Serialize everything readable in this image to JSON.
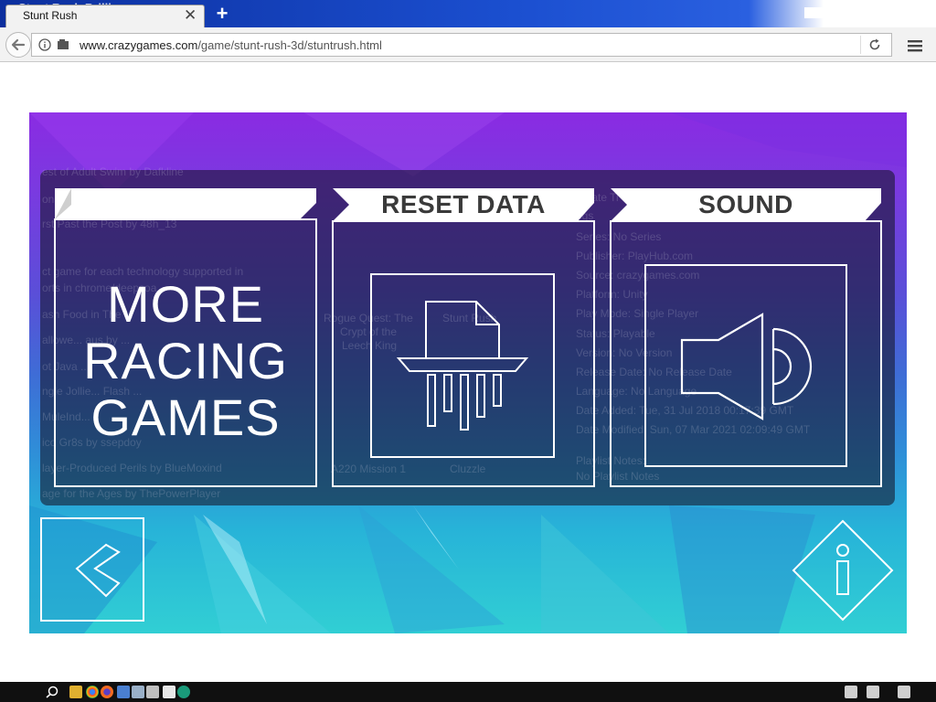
{
  "browser": {
    "window_title_ghost": "Stunt Rush Brilli",
    "tab_title": "Stunt Rush",
    "tab_close": "✕",
    "new_tab": "+",
    "url_host": "www.crazygames.com",
    "url_path": "/game/stunt-rush-3d/stuntrush.html"
  },
  "game": {
    "panels": {
      "more_games": [
        "MORE",
        "RACING",
        "GAMES"
      ],
      "reset_title": "RESET DATA",
      "sound_title": "SOUND"
    },
    "ghost_text": [
      "est of Adult Swim by Dafkline",
      "onsol",
      "rst Past the Post by 48h_13",
      "ct game for each technology supported in",
      "orts in chrome/deepsoa",
      "ash Food in The ...",
      "allowe... aus by ...",
      "ot Java ... ",
      "ngle Jollie... Flash ...",
      "MuleInd...",
      "ico Gr8s by ssepdoy",
      "layer-Produced Perils by BlueMoxind",
      "age for the Ages by ThePowerPlayer",
      "Rogue Quest: The",
      "Crypt of the",
      "Leech King",
      "Stunt Rush",
      "A220 Mission 1",
      "Cluzzle",
      "ernate Ti",
      "ogs",
      "Series: No Series",
      "Publisher: PlayHub.com",
      "Source: crazygames.com",
      "Platform: Unity",
      "Play Mode: Single Player",
      "Status: Playable",
      "Version: No Version",
      "Release Date: No Release Date",
      "Language: No Language",
      "Date Added: Tue, 31 Jul 2018 00:17:39 GMT",
      "Date Modified: Sun, 07 Mar 2021 02:09:49 GMT",
      "Playlist Notes:",
      "No Playlist Notes"
    ]
  },
  "colors": {
    "overlay": "#1b1a33",
    "panel_stroke": "#ffffff",
    "title_text": "#3a3a3a"
  },
  "icons": {
    "back": "arrow-left-icon",
    "info": "info-icon",
    "reload": "reload-icon",
    "menu": "hamburger-menu-icon",
    "shredder": "shredder-icon",
    "speaker": "speaker-icon",
    "game_back": "chevron-left-icon",
    "game_info": "info-diamond-icon"
  }
}
